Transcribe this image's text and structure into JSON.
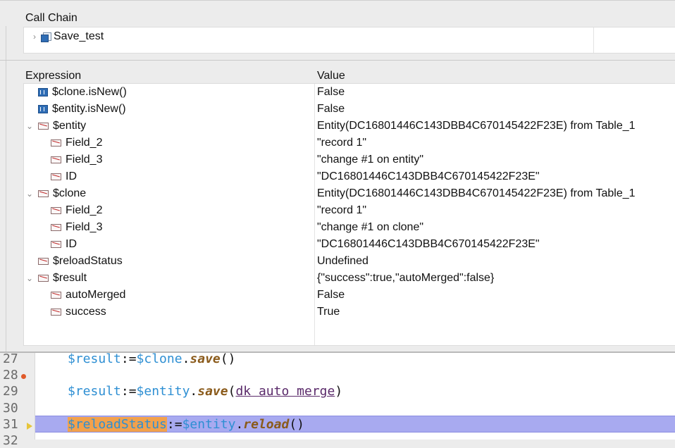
{
  "call_chain": {
    "title": "Call Chain",
    "items": [
      {
        "label": "Save_test"
      }
    ]
  },
  "expressions": {
    "columns": {
      "expression": "Expression",
      "value": "Value"
    },
    "rows": [
      {
        "name": "$clone.isNew()",
        "value": "False",
        "icon": "boolean-icon",
        "level": 0,
        "expandable": false
      },
      {
        "name": "$entity.isNew()",
        "value": "False",
        "icon": "boolean-icon",
        "level": 0,
        "expandable": false
      },
      {
        "name": "$entity",
        "value": "Entity(DC16801446C143DBB4C670145422F23E) from Table_1",
        "icon": "object-icon",
        "level": 0,
        "expandable": true
      },
      {
        "name": "Field_2",
        "value": "\"record 1\"",
        "icon": "object-icon",
        "level": 1,
        "expandable": false
      },
      {
        "name": "Field_3",
        "value": "\"change #1 on entity\"",
        "icon": "object-icon",
        "level": 1,
        "expandable": false
      },
      {
        "name": "ID",
        "value": "\"DC16801446C143DBB4C670145422F23E\"",
        "icon": "object-icon",
        "level": 1,
        "expandable": false
      },
      {
        "name": "$clone",
        "value": "Entity(DC16801446C143DBB4C670145422F23E) from Table_1",
        "icon": "object-icon",
        "level": 0,
        "expandable": true
      },
      {
        "name": "Field_2",
        "value": "\"record 1\"",
        "icon": "object-icon",
        "level": 1,
        "expandable": false
      },
      {
        "name": "Field_3",
        "value": "\"change #1 on clone\"",
        "icon": "object-icon",
        "level": 1,
        "expandable": false
      },
      {
        "name": "ID",
        "value": "\"DC16801446C143DBB4C670145422F23E\"",
        "icon": "object-icon",
        "level": 1,
        "expandable": false
      },
      {
        "name": "$reloadStatus",
        "value": "Undefined",
        "icon": "object-icon",
        "level": 0,
        "expandable": false
      },
      {
        "name": "$result",
        "value": "{\"success\":true,\"autoMerged\":false}",
        "icon": "object-icon",
        "level": 0,
        "expandable": true
      },
      {
        "name": "autoMerged",
        "value": "False",
        "icon": "object-icon",
        "level": 1,
        "expandable": false
      },
      {
        "name": "success",
        "value": "True",
        "icon": "object-icon",
        "level": 1,
        "expandable": false
      }
    ]
  },
  "code": {
    "lines": [
      {
        "number": "27",
        "tokens": [
          {
            "t": "$result",
            "c": "v"
          },
          {
            "t": ":=",
            "c": "p"
          },
          {
            "t": "$clone",
            "c": "v"
          },
          {
            "t": ".",
            "c": "p"
          },
          {
            "t": "save",
            "c": "m"
          },
          {
            "t": "()",
            "c": "p"
          }
        ]
      },
      {
        "number": "28",
        "breakpoint": true,
        "tokens": []
      },
      {
        "number": "29",
        "tokens": [
          {
            "t": "$result",
            "c": "v"
          },
          {
            "t": ":=",
            "c": "p"
          },
          {
            "t": "$entity",
            "c": "v"
          },
          {
            "t": ".",
            "c": "p"
          },
          {
            "t": "save",
            "c": "m"
          },
          {
            "t": "(",
            "c": "p"
          },
          {
            "t": "dk auto merge",
            "c": "c"
          },
          {
            "t": ")",
            "c": "p"
          }
        ]
      },
      {
        "number": "30",
        "tokens": []
      },
      {
        "number": "31",
        "current": true,
        "tokens": [
          {
            "t": "$reloadStatus",
            "c": "vhl"
          },
          {
            "t": ":=",
            "c": "p"
          },
          {
            "t": "$entity",
            "c": "v"
          },
          {
            "t": ".",
            "c": "p"
          },
          {
            "t": "reload",
            "c": "m"
          },
          {
            "t": "()",
            "c": "p"
          }
        ]
      },
      {
        "number": "32",
        "tokens": []
      }
    ]
  }
}
